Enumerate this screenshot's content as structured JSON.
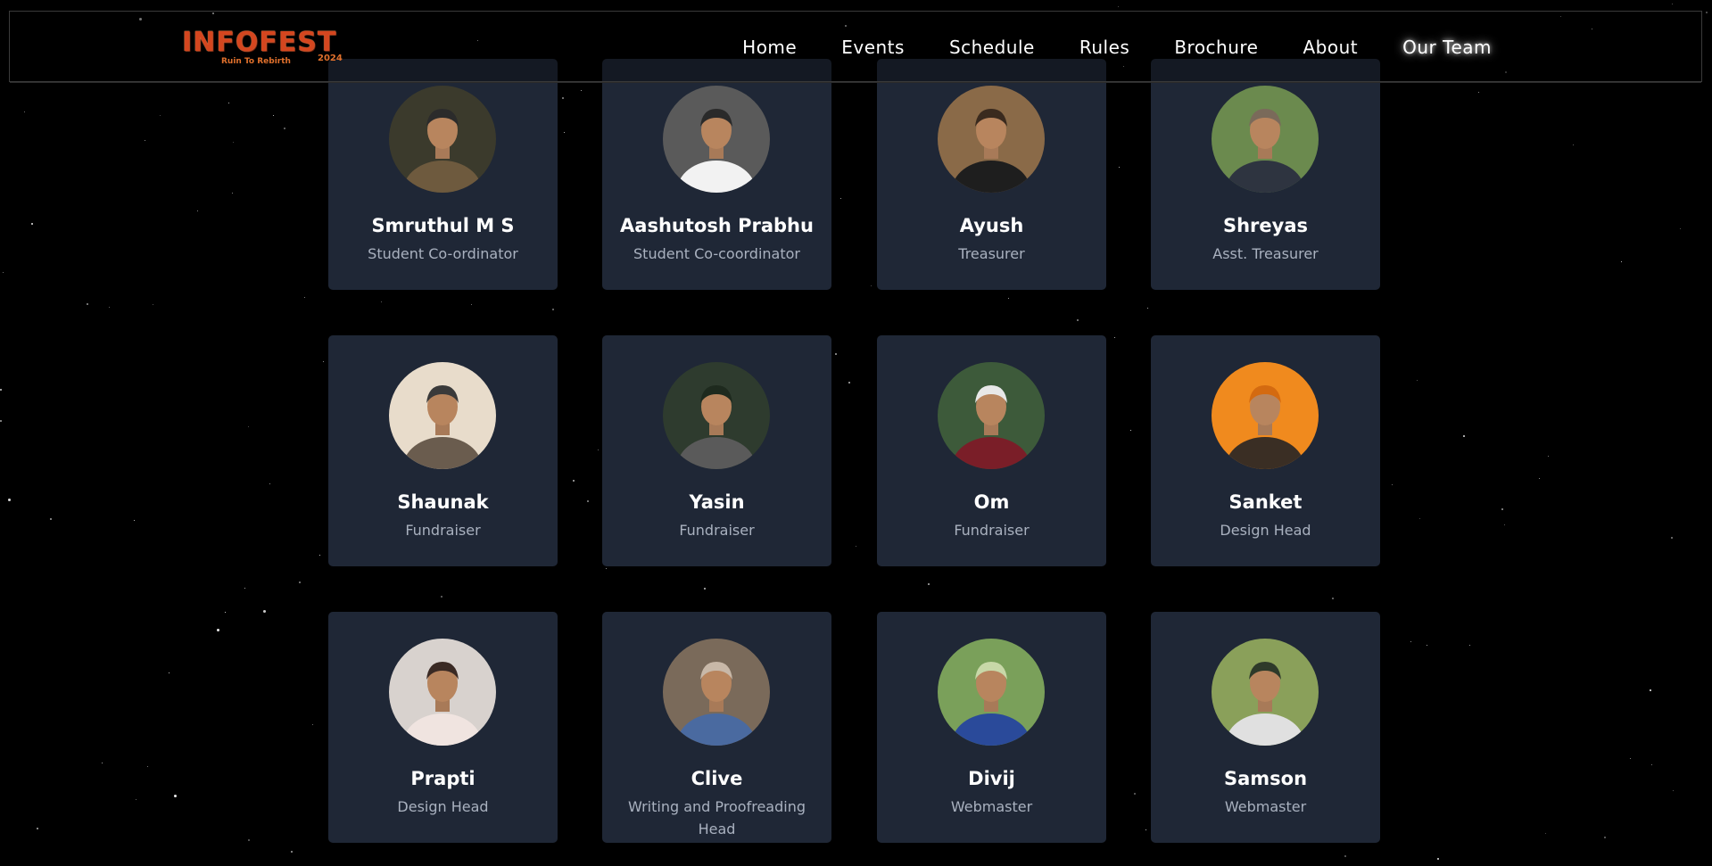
{
  "brand": {
    "logo_text": "INFOFEST",
    "tagline": "Ruin To Rebirth",
    "year": "2024"
  },
  "nav": {
    "items": [
      {
        "label": "Home"
      },
      {
        "label": "Events"
      },
      {
        "label": "Schedule"
      },
      {
        "label": "Rules"
      },
      {
        "label": "Brochure"
      },
      {
        "label": "About"
      },
      {
        "label": "Our Team"
      }
    ],
    "active": "Our Team"
  },
  "team": [
    {
      "name": "Smruthul M S",
      "role": "Student Co-ordinator",
      "avatar": "portrait-photo"
    },
    {
      "name": "Aashutosh Prabhu",
      "role": "Student Co-coordinator",
      "avatar": "portrait-photo"
    },
    {
      "name": "Ayush",
      "role": "Treasurer",
      "avatar": "portrait-photo"
    },
    {
      "name": "Shreyas",
      "role": "Asst. Treasurer",
      "avatar": "portrait-photo"
    },
    {
      "name": "Shaunak",
      "role": "Fundraiser",
      "avatar": "portrait-photo"
    },
    {
      "name": "Yasin",
      "role": "Fundraiser",
      "avatar": "portrait-photo"
    },
    {
      "name": "Om",
      "role": "Fundraiser",
      "avatar": "portrait-photo"
    },
    {
      "name": "Sanket",
      "role": "Design Head",
      "avatar": "portrait-photo"
    },
    {
      "name": "Prapti",
      "role": "Design Head",
      "avatar": "portrait-photo"
    },
    {
      "name": "Clive",
      "role": "Writing and Proofreading Head",
      "avatar": "portrait-photo"
    },
    {
      "name": "Divij",
      "role": "Webmaster",
      "avatar": "portrait-photo"
    },
    {
      "name": "Samson",
      "role": "Webmaster",
      "avatar": "portrait-photo"
    }
  ],
  "colors": {
    "background": "#000000",
    "card": "#1f2736",
    "name_text": "#ffffff",
    "role_text": "#a9b1bf",
    "logo_accent": "#d4461f"
  }
}
